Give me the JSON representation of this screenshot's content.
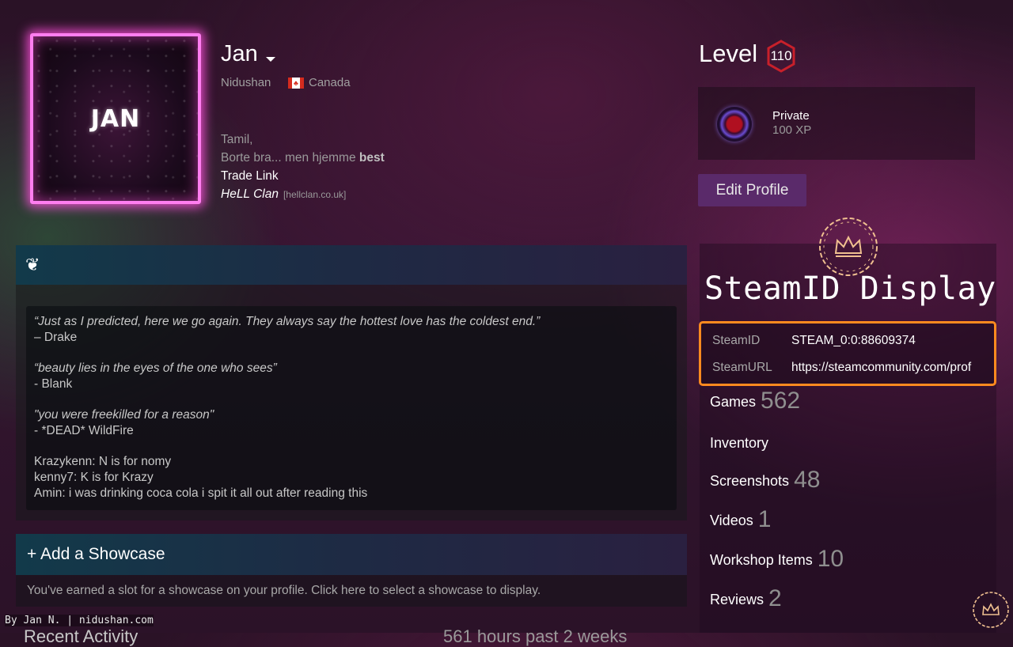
{
  "profile": {
    "avatar_text": "JAN",
    "persona_name": "Jan",
    "real_name": "Nidushan",
    "country": "Canada",
    "flag_icon": "canada-flag-icon",
    "summary": {
      "line1": "Tamil,",
      "line2_prefix": "Borte bra... men hjemme ",
      "line2_bold": "best",
      "line3": "Trade Link",
      "clan_name": "HeLL Clan",
      "clan_url": "[hellclan.co.uk]"
    }
  },
  "level": {
    "label": "Level",
    "value": "110",
    "badge_color": "#c8202a"
  },
  "xp_badge": {
    "title": "Private",
    "xp": "100 XP"
  },
  "edit_profile_label": "Edit Profile",
  "steamid_display": {
    "title": "SteamID Display",
    "rows": [
      {
        "key": "SteamID",
        "value": "STEAM_0:0:88609374"
      },
      {
        "key": "SteamURL",
        "value": "https://steamcommunity.com/prof"
      }
    ],
    "highlight_color": "#ff8a1f"
  },
  "stats": [
    {
      "label": "Games",
      "count": "562"
    },
    {
      "label": "Inventory",
      "count": ""
    },
    {
      "label": "Screenshots",
      "count": "48"
    },
    {
      "label": "Videos",
      "count": "1"
    },
    {
      "label": "Workshop Items",
      "count": "10"
    },
    {
      "label": "Reviews",
      "count": "2"
    }
  ],
  "quote_showcase": {
    "icon": "quote-icon",
    "quotes": [
      {
        "text": "“Just as I predicted, here we go again. They always say the hottest love has the coldest end.”",
        "author": "– Drake"
      },
      {
        "text": "“beauty lies in the eyes of the one who sees”",
        "author": "- Blank"
      },
      {
        "text": "\"you were freekilled for a reason\"",
        "author": "- *DEAD* WildFire"
      }
    ],
    "chat_lines": [
      "Krazykenn: N is for nomy",
      "kenny7: K is for Krazy",
      "Amin: i was drinking coca cola i spit it all out after reading this"
    ]
  },
  "add_showcase": {
    "title": "+ Add a Showcase",
    "text": "You've earned a slot for a showcase on your profile. Click here to select a showcase to display."
  },
  "footer": {
    "watermark": "By Jan N. | nidushan.com",
    "cut_left": "Recent Activity",
    "cut_right": "561 hours past 2 weeks"
  }
}
